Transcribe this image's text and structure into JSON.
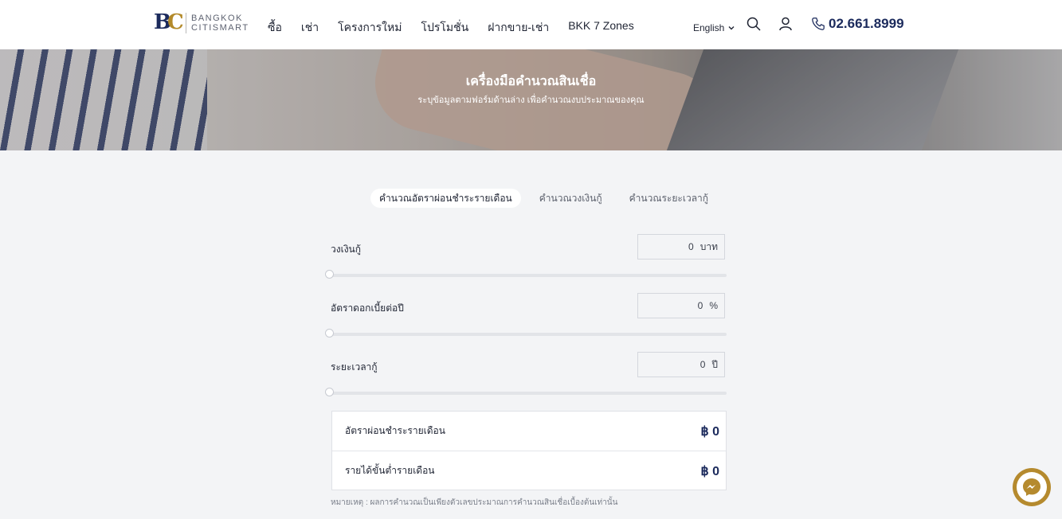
{
  "brand": {
    "line1": "BANGKOK",
    "line2": "CITISMART"
  },
  "nav": [
    "ซื้อ",
    "เช่า",
    "โครงการใหม่",
    "โปรโมชั่น",
    "ฝากขาย-เช่า",
    "BKK 7 Zones"
  ],
  "header": {
    "language": "English",
    "phone": "02.661.8999"
  },
  "banner": {
    "title": "เครื่องมือคำนวณสินเชื่อ",
    "subtitle": "ระบุข้อมูลตามฟอร์มด้านล่าง เพื่อคำนวณงบประมาณของคุณ"
  },
  "tabs": [
    {
      "label": "คำนวณอัตราผ่อนชำระรายเดือน",
      "active": true
    },
    {
      "label": "คำนวณวงเงินกู้",
      "active": false
    },
    {
      "label": "คำนวณระยะเวลากู้",
      "active": false
    }
  ],
  "fields": [
    {
      "label": "วงเงินกู้",
      "value": "0",
      "unit": "บาท",
      "slider": 0
    },
    {
      "label": "อัตราดอกเบี้ยต่อปี",
      "value": "0",
      "unit": "%",
      "slider": 0
    },
    {
      "label": "ระยะเวลากู้",
      "value": "0",
      "unit": "ปี",
      "slider": 0
    }
  ],
  "results": [
    {
      "label": "อัตราผ่อนชำระรายเดือน",
      "value": "฿ 0"
    },
    {
      "label": "รายได้ขั้นต่ำรายเดือน",
      "value": "฿ 0"
    }
  ],
  "note": "หมายเหตุ : ผลการคำนวณเป็นเพียงตัวเลขประมาณการคำนวณสินเชื่อเบื้องต้นเท่านั้น",
  "colors": {
    "brand_navy": "#1b2a5c",
    "brand_gold": "#b58a2e"
  }
}
